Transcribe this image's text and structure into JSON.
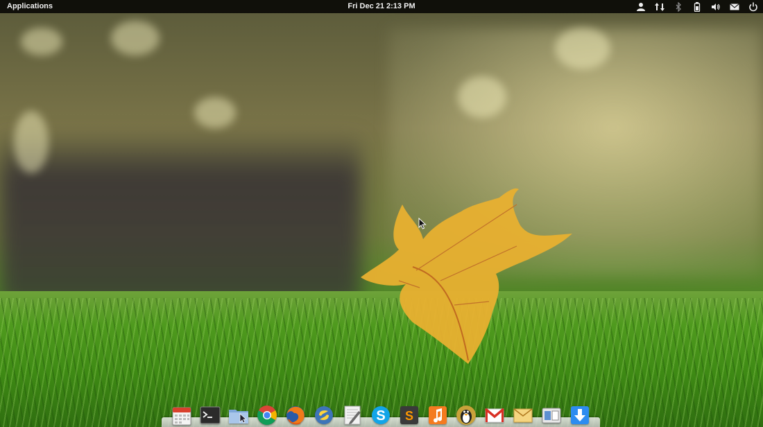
{
  "top_panel": {
    "applications_label": "Applications",
    "clock": "Fri Dec 21  2:13 PM",
    "indicators": [
      {
        "icon": "user-icon"
      },
      {
        "icon": "network-transfer-icon"
      },
      {
        "icon": "bluetooth-icon"
      },
      {
        "icon": "battery-icon"
      },
      {
        "icon": "volume-icon"
      },
      {
        "icon": "mail-icon"
      },
      {
        "icon": "power-icon"
      }
    ]
  },
  "dock": {
    "items": [
      {
        "icon": "calendar-icon"
      },
      {
        "icon": "terminal-icon"
      },
      {
        "icon": "files-icon"
      },
      {
        "icon": "chrome-icon"
      },
      {
        "icon": "firefox-icon"
      },
      {
        "icon": "python-icon"
      },
      {
        "icon": "text-editor-icon"
      },
      {
        "icon": "skype-icon"
      },
      {
        "icon": "sublime-text-icon"
      },
      {
        "icon": "music-icon"
      },
      {
        "icon": "tux-icon"
      },
      {
        "icon": "gmail-icon"
      },
      {
        "icon": "mail-client-icon"
      },
      {
        "icon": "workspace-switcher-icon"
      },
      {
        "icon": "downloads-icon"
      }
    ]
  },
  "colors": {
    "panel_bg": "#000000",
    "panel_text": "#f2f2f2",
    "leaf": "#e8b030",
    "grass": "#4f9a1e"
  }
}
